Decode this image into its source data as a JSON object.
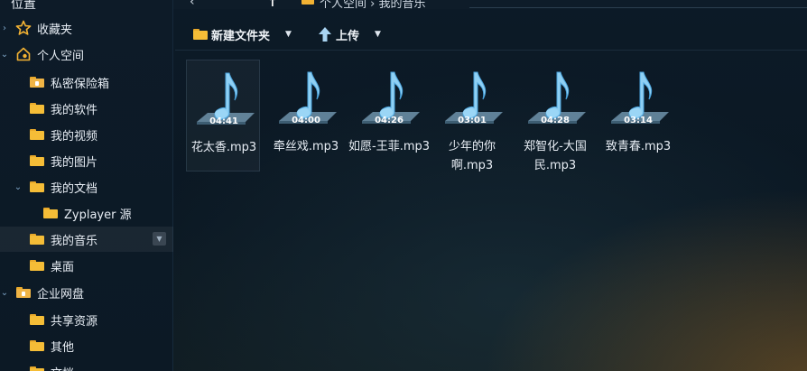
{
  "header": {
    "back_glyph": "‹",
    "up_glyph": "↑",
    "breadcrumb_text": "个人空间 › 我的音乐"
  },
  "sidebar": {
    "heading": "位置",
    "items": [
      {
        "label": "收藏夹",
        "icon": "star-icon"
      },
      {
        "label": "个人空间",
        "icon": "house-icon"
      },
      {
        "label": "私密保险箱",
        "icon": "lock-folder-icon"
      },
      {
        "label": "我的软件",
        "icon": "folder-icon"
      },
      {
        "label": "我的视频",
        "icon": "folder-icon"
      },
      {
        "label": "我的图片",
        "icon": "folder-icon"
      },
      {
        "label": "我的文档",
        "icon": "folder-icon"
      },
      {
        "label": "Zyplayer 源",
        "icon": "folder-icon"
      },
      {
        "label": "我的音乐",
        "icon": "folder-icon"
      },
      {
        "label": "桌面",
        "icon": "folder-icon"
      },
      {
        "label": "企业网盘",
        "icon": "enterprise-folder-icon"
      },
      {
        "label": "共享资源",
        "icon": "folder-icon"
      },
      {
        "label": "其他",
        "icon": "folder-icon"
      },
      {
        "label": "文档",
        "icon": "folder-icon"
      }
    ]
  },
  "toolbar": {
    "new_folder_label": "新建文件夹",
    "upload_label": "上传",
    "caret": "▼"
  },
  "files": [
    {
      "name": "花太香.mp3",
      "duration": "04:41"
    },
    {
      "name": "牵丝戏.mp3",
      "duration": "04:00"
    },
    {
      "name": "如愿-王菲.mp3",
      "duration": "04:26"
    },
    {
      "name": "少年的你啊.mp3",
      "duration": "03:01"
    },
    {
      "name": "郑智化-大国民.mp3",
      "duration": "04:28"
    },
    {
      "name": "致青春.mp3",
      "duration": "03:14"
    }
  ],
  "colors": {
    "accent": "#2f8bd6",
    "folder": "#f5bd37",
    "note": "#8fd0f4"
  }
}
